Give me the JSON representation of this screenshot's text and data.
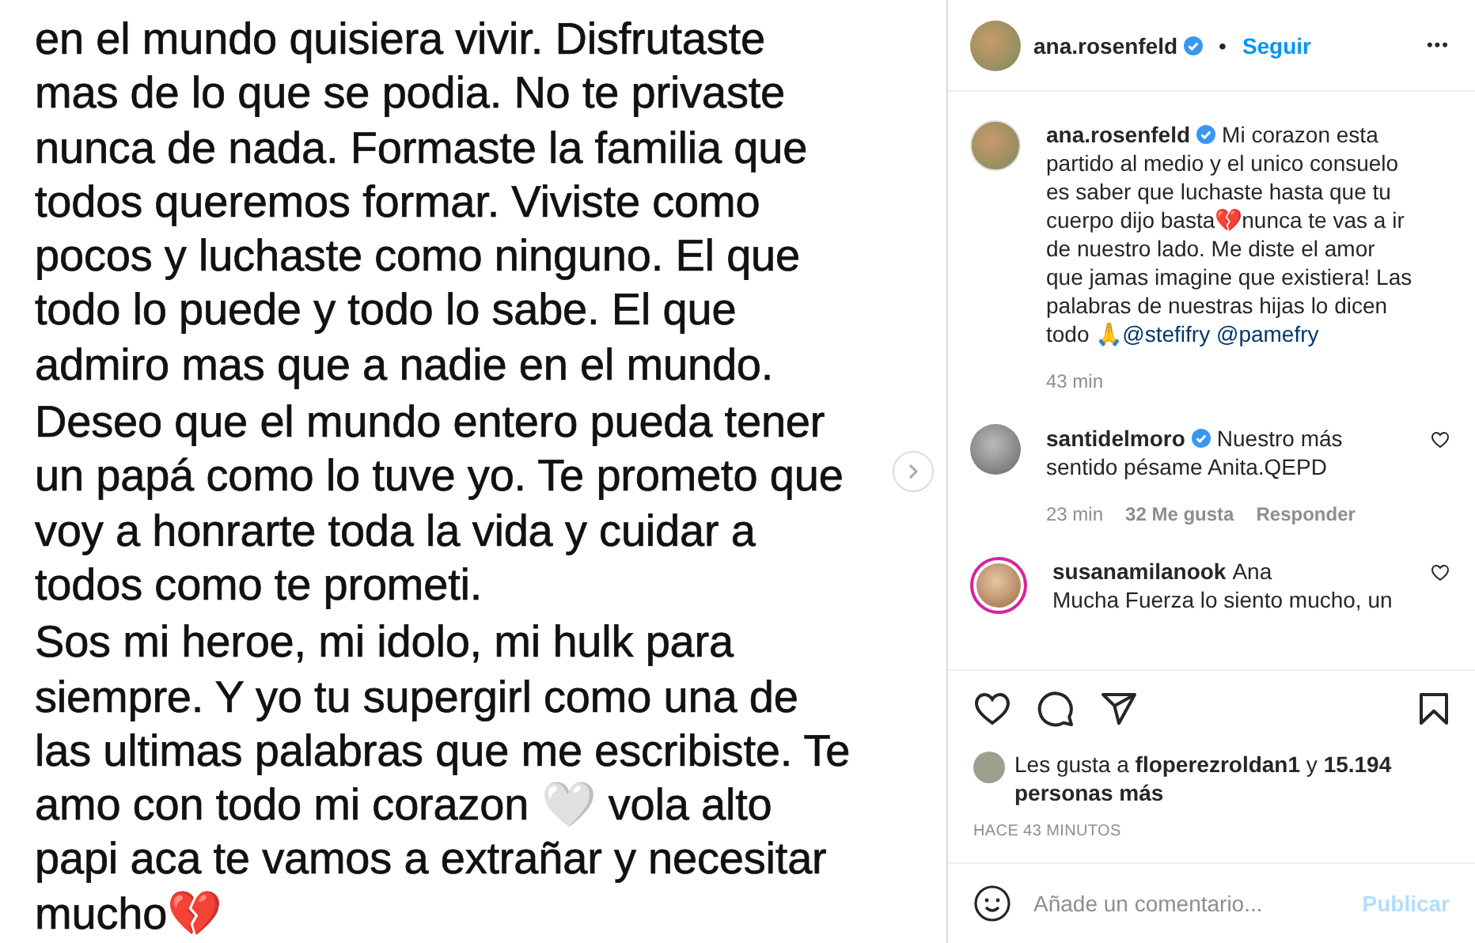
{
  "post_image": {
    "paragraphs": [
      "en el mundo quisiera vivir. Disfrutaste\nmas de lo que se podia. No te privaste\nnunca de nada. Formaste la familia que\ntodos queremos formar. Viviste como\npocos y luchaste como ninguno. El que\ntodo lo puede y todo lo sabe. El que\nadmiro mas que a nadie en el mundo.",
      "Deseo que el mundo entero pueda tener\nun papá como lo tuve yo. Te prometo que\nvoy a honrarte toda la vida y cuidar a\ntodos como te prometi.",
      "Sos mi heroe, mi idolo, mi hulk para\nsiempre. Y yo tu supergirl como una de\nlas ultimas palabras que me escribiste. Te\namo con todo mi corazon 🤍 vola alto\npapi aca te vamos a extrañar y necesitar\nmucho💔"
    ]
  },
  "header": {
    "username": "ana.rosenfeld",
    "verified": true,
    "separator": "•",
    "follow": "Seguir",
    "more": "•••"
  },
  "caption": {
    "username": "ana.rosenfeld",
    "verified": true,
    "text": "Mi corazon esta partido al medio y el unico consuelo es saber que luchaste hasta que tu cuerpo dijo basta💔nunca te vas a ir de nuestro lado. Me diste el amor que jamas imagine que existiera! Las palabras de nuestras hijas lo dicen todo 🙏",
    "mentions": [
      "@stefifry",
      "@pamefry"
    ],
    "time": "43 min"
  },
  "comments": [
    {
      "username": "santidelmoro",
      "verified": true,
      "has_story": false,
      "text": "Nuestro más sentido pésame Anita.QEPD",
      "time": "23 min",
      "likes": "32 Me gusta",
      "reply": "Responder"
    },
    {
      "username": "susanamilanook",
      "verified": false,
      "has_story": true,
      "text": "Ana\nMucha Fuerza lo siento mucho, un"
    }
  ],
  "likes": {
    "text": "Les gusta a **floperezroldan1** y **15.194 personas más**"
  },
  "timestamp": "HACE 43 MINUTOS",
  "comment_box": {
    "placeholder": "Añade un comentario...",
    "publish": "Publicar",
    "publish_disabled": true
  }
}
